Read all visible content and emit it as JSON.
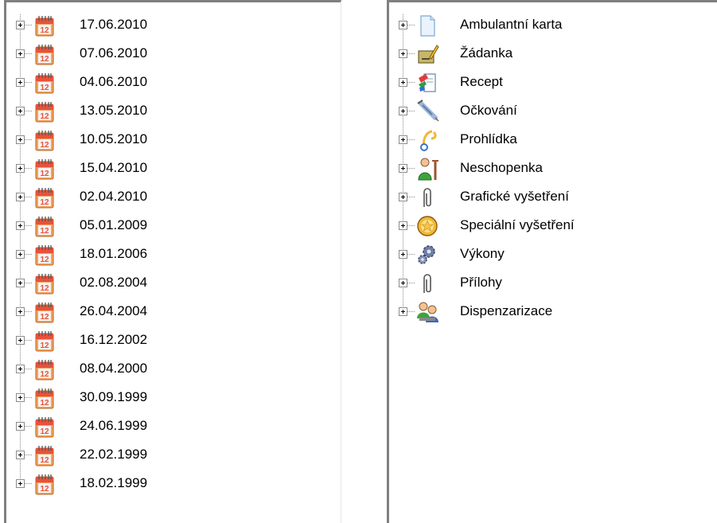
{
  "dates_tree": {
    "items": [
      {
        "label": "17.06.2010",
        "icon": "calendar-icon"
      },
      {
        "label": "07.06.2010",
        "icon": "calendar-icon"
      },
      {
        "label": "04.06.2010",
        "icon": "calendar-icon"
      },
      {
        "label": "13.05.2010",
        "icon": "calendar-icon"
      },
      {
        "label": "10.05.2010",
        "icon": "calendar-icon"
      },
      {
        "label": "15.04.2010",
        "icon": "calendar-icon"
      },
      {
        "label": "02.04.2010",
        "icon": "calendar-icon"
      },
      {
        "label": "05.01.2009",
        "icon": "calendar-icon"
      },
      {
        "label": "18.01.2006",
        "icon": "calendar-icon"
      },
      {
        "label": "02.08.2004",
        "icon": "calendar-icon"
      },
      {
        "label": "26.04.2004",
        "icon": "calendar-icon"
      },
      {
        "label": "16.12.2002",
        "icon": "calendar-icon"
      },
      {
        "label": "08.04.2000",
        "icon": "calendar-icon"
      },
      {
        "label": "30.09.1999",
        "icon": "calendar-icon"
      },
      {
        "label": "24.06.1999",
        "icon": "calendar-icon"
      },
      {
        "label": "22.02.1999",
        "icon": "calendar-icon"
      },
      {
        "label": "18.02.1999",
        "icon": "calendar-icon"
      }
    ],
    "calendar_day": "12"
  },
  "categories_tree": {
    "items": [
      {
        "label": "Ambulantní karta",
        "icon": "document-icon"
      },
      {
        "label": "Žádanka",
        "icon": "request-form-icon"
      },
      {
        "label": "Recept",
        "icon": "prescription-icon"
      },
      {
        "label": "Očkování",
        "icon": "syringe-icon"
      },
      {
        "label": "Prohlídka",
        "icon": "stethoscope-icon"
      },
      {
        "label": "Neschopenka",
        "icon": "patient-crutch-icon"
      },
      {
        "label": "Grafické vyšetření",
        "icon": "paperclip-icon"
      },
      {
        "label": "Speciální vyšetření",
        "icon": "star-circle-icon"
      },
      {
        "label": "Výkony",
        "icon": "gears-icon"
      },
      {
        "label": "Přílohy",
        "icon": "paperclip-icon"
      },
      {
        "label": "Dispenzarizace",
        "icon": "people-icon"
      }
    ]
  },
  "colors": {
    "panel_border": "#808080",
    "calendar_red": "#e8523a",
    "calendar_orange": "#f7a25c",
    "tree_line": "#8c8c8c"
  }
}
